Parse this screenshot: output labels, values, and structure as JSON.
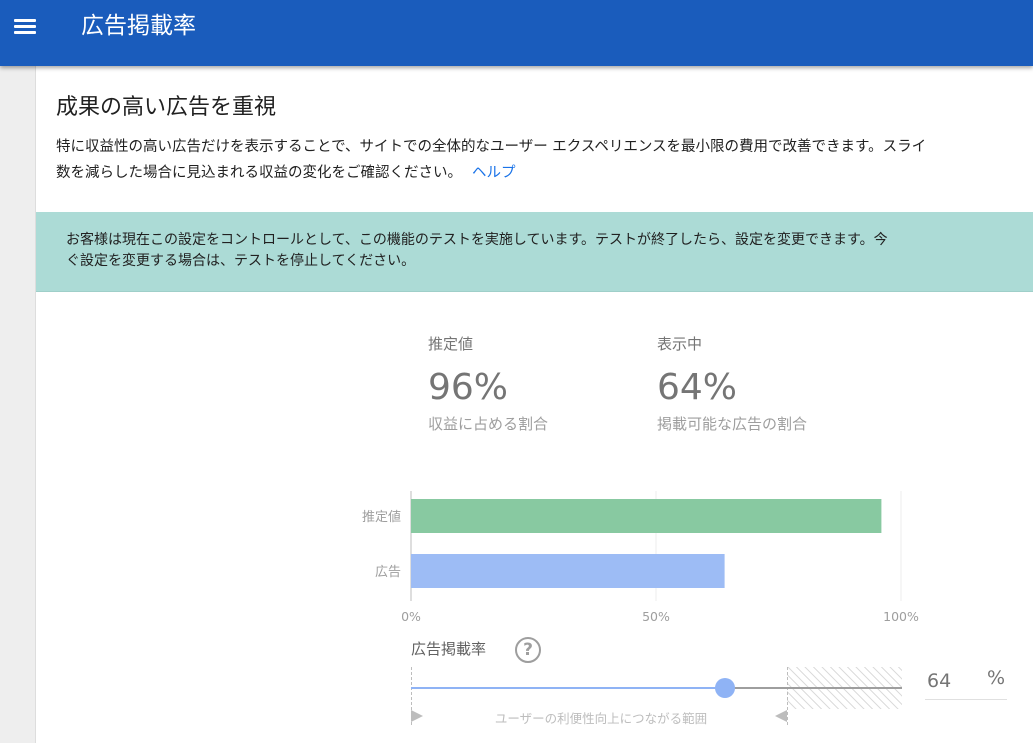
{
  "header": {
    "title": "広告掲載率"
  },
  "card": {
    "title": "成果の高い広告を重視",
    "description_line1": "特に収益性の高い広告だけを表示することで、サイトでの全体的なユーザー エクスペリエンスを最小限の費用で改善できます。スライ",
    "description_line2": "数を減らした場合に見込まれる収益の変化をご確認ください。",
    "help_link": "ヘルプ"
  },
  "banner": {
    "line1": "お客様は現在この設定をコントロールとして、この機能のテストを実施しています。テストが終了したら、設定を変更できます。今",
    "line2": "ぐ設定を変更する場合は、テストを停止してください。"
  },
  "stats": [
    {
      "label": "推定値",
      "value": "96%",
      "sub": "収益に占める割合"
    },
    {
      "label": "表示中",
      "value": "64%",
      "sub": "掲載可能な広告の割合"
    }
  ],
  "chart_data": {
    "type": "bar",
    "orientation": "horizontal",
    "categories": [
      "推定値",
      "広告"
    ],
    "values": [
      96,
      64
    ],
    "colors": [
      "#88c9a1",
      "#9dbcf5"
    ],
    "xlim": [
      0,
      100
    ],
    "xticks": [
      "0%",
      "50%",
      "100%"
    ],
    "grid": true
  },
  "slider": {
    "label": "広告掲載率",
    "value": 64,
    "recommended_max": 77,
    "range_text": "ユーザーの利便性向上につながる範囲",
    "input_value": "64",
    "unit": "%",
    "colors": {
      "accent": "#8fb3f5"
    }
  },
  "colors": {
    "appbar": "#1a5cbc",
    "banner": "#acdbd6",
    "link": "#1a73e8"
  }
}
